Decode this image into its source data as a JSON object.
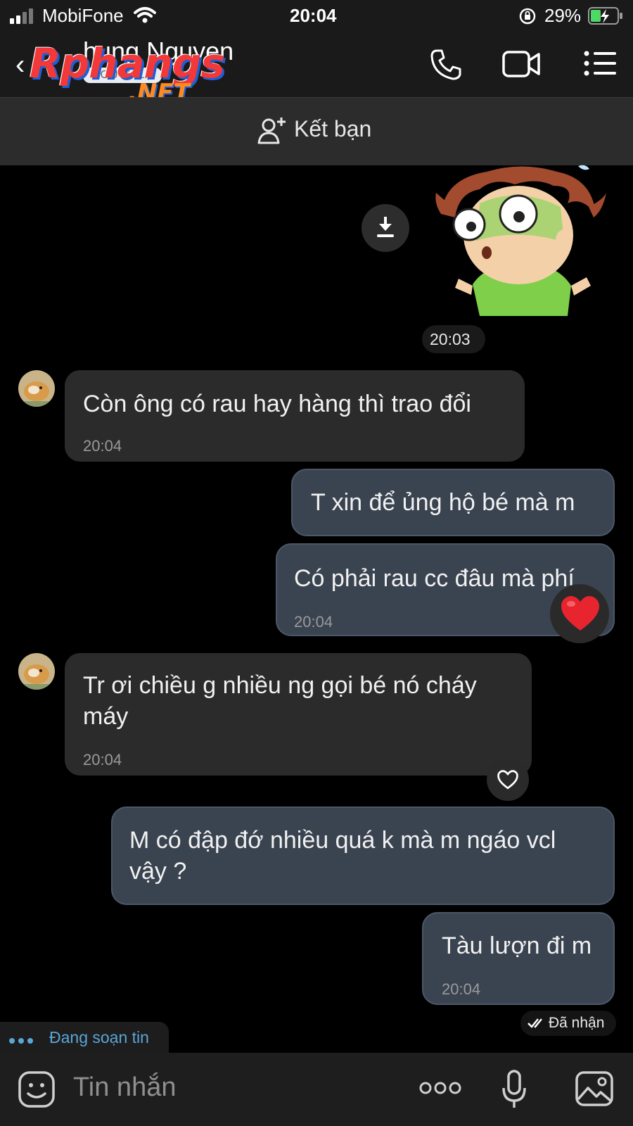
{
  "status_bar": {
    "carrier": "MobiFone",
    "time": "20:04",
    "battery": "29%"
  },
  "header": {
    "contact_name": "hung Nguyen",
    "badge": "NGƯỜI LẠ",
    "watermark": "Rphangs",
    "watermark_suffix": ".NET",
    "icons": [
      "back-icon",
      "phone-icon",
      "video-call-icon",
      "menu-list-icon"
    ]
  },
  "friend_bar": {
    "label": "Kết bạn",
    "icon": "add-friend-icon"
  },
  "sticker": {
    "time": "20:03"
  },
  "messages": [
    {
      "side": "in",
      "text": "Còn ông có rau hay hàng thì trao đổi",
      "time": "20:04"
    },
    {
      "side": "out",
      "text": "T xin để ủng hộ bé mà m"
    },
    {
      "side": "out",
      "text": "Có phải rau cc đâu mà phí",
      "time": "20:04",
      "reaction": "heart"
    },
    {
      "side": "in",
      "text": "Tr ơi chiều g nhiều ng gọi bé nó cháy máy",
      "time": "20:04"
    },
    {
      "side": "out",
      "text": "M có đập đớ nhiều quá k mà m ngáo vcl vậy ?"
    },
    {
      "side": "out",
      "text": "Tàu lượn đi m",
      "time": "20:04"
    }
  ],
  "receipt": "Đã nhận",
  "typing_indicator": "Đang soạn tin",
  "composer": {
    "placeholder": "Tin nhắn"
  },
  "colors": {
    "incoming_bubble": "#2b2b2b",
    "outgoing_bubble": "#3a4350",
    "typing_blue": "#5aa6d6",
    "heart_red": "#e8242f"
  }
}
